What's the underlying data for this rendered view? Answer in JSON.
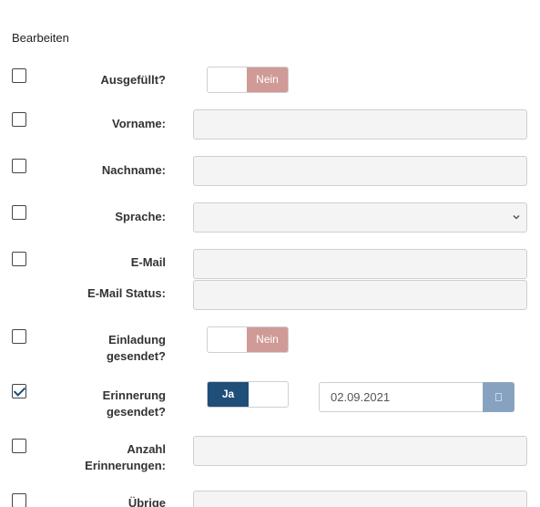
{
  "form": {
    "title": "Bearbeiten",
    "rows": [
      {
        "label": "Ausgefüllt?",
        "type": "toggle",
        "value": "Nein",
        "checked": false
      },
      {
        "label": "Vorname:",
        "type": "text",
        "value": "",
        "checked": false
      },
      {
        "label": "Nachname:",
        "type": "text",
        "value": "",
        "checked": false
      },
      {
        "label": "Sprache:",
        "type": "select",
        "value": "",
        "checked": false
      },
      {
        "label": "E-Mail",
        "type": "text",
        "value": "",
        "checked": false
      },
      {
        "label": "E-Mail Status:",
        "type": "text",
        "value": ""
      },
      {
        "label_line1": "Einladung",
        "label_line2": "gesendet?",
        "type": "toggle",
        "value": "Nein",
        "checked": false
      },
      {
        "label_line1": "Erinnerung",
        "label_line2": "gesendet?",
        "type": "toggle",
        "value": "Ja",
        "checked": true,
        "date": "02.09.2021"
      },
      {
        "label_line1": "Anzahl",
        "label_line2": "Erinnerungen:",
        "type": "text",
        "value": "",
        "checked": false
      },
      {
        "label_line1": "Übrige",
        "type": "text",
        "value": "",
        "checked": false
      }
    ]
  },
  "colors": {
    "no_toggle": "#d09a96",
    "yes_toggle": "#1f4e79",
    "date_button": "#86a2c0",
    "field_bg": "#f4f4f4"
  },
  "icons": {
    "calendar": "calendar-icon",
    "chevron": "chevron-down-icon",
    "check": "check-icon"
  }
}
